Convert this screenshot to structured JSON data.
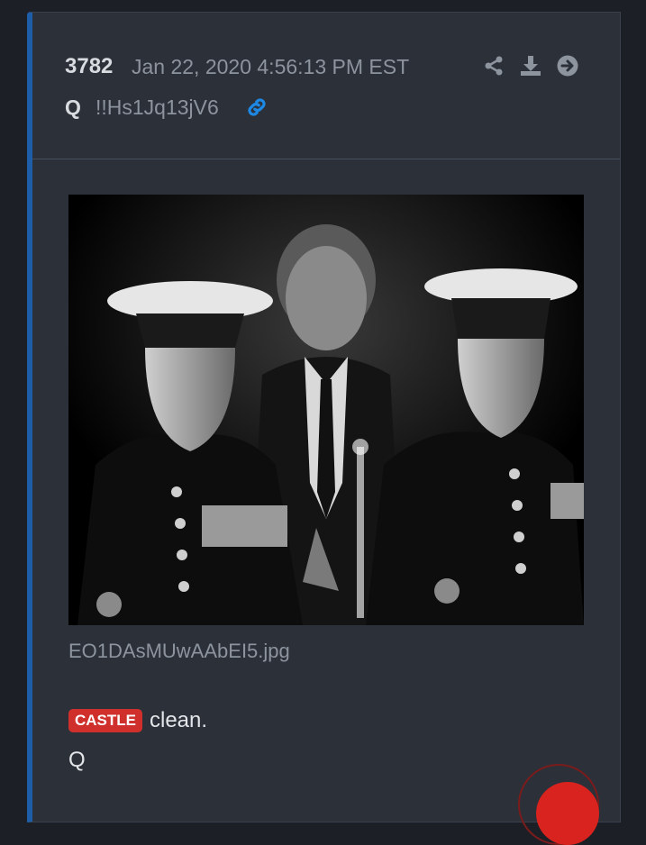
{
  "post": {
    "number": "3782",
    "date": "Jan 22, 2020 4:56:13 PM EST",
    "author": "Q",
    "tripcode": "!!Hs1Jq13jV6"
  },
  "attachment": {
    "filename": "EO1DAsMUwAAbEI5.jpg"
  },
  "message": {
    "tag": "CASTLE",
    "text": "clean.",
    "signature": "Q"
  },
  "icons": [
    "share-icon",
    "download-icon",
    "arrow-right-circle-icon",
    "link-icon"
  ],
  "colors": {
    "card_bg": "#2b3039",
    "accent_bar": "#1e5ea8",
    "tag_bg": "#d0302b",
    "link_icon": "#1e88e5"
  }
}
